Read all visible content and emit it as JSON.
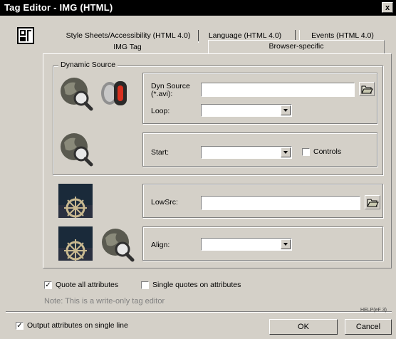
{
  "window": {
    "title": "Tag Editor - IMG  (HTML)",
    "close_glyph": "x"
  },
  "tabs_row1": [
    "Style Sheets/Accessibility (HTML 4.0)",
    "Language (HTML 4.0)",
    "Events (HTML 4.0)"
  ],
  "tabs_row2": [
    "IMG Tag",
    "Browser-specific"
  ],
  "dynamic_source": {
    "group_title": "Dynamic Source",
    "dyn_source_label": "Dyn Source\n(*.avi):",
    "dyn_source_value": "",
    "loop_label": "Loop:",
    "loop_value": "",
    "start_label": "Start:",
    "start_value": "",
    "controls_label": "Controls",
    "controls_checked": false
  },
  "lowsrc": {
    "label": "LowSrc:",
    "value": ""
  },
  "align": {
    "label": "Align:",
    "value": ""
  },
  "options": {
    "quote_all_label": "Quote all attributes",
    "quote_all_checked": true,
    "single_quotes_label": "Single quotes on attributes",
    "single_quotes_checked": false,
    "note": "Note: This is a write-only tag editor"
  },
  "footer": {
    "output_single_line_label": "Output attributes on single line",
    "output_single_line_checked": true,
    "help_label": "HELP(eF 3)",
    "ok_label": "OK",
    "cancel_label": "Cancel"
  },
  "colors": {
    "dialog_bg": "#d4d0c8",
    "title_bg": "#000000",
    "note_text": "#808080"
  }
}
